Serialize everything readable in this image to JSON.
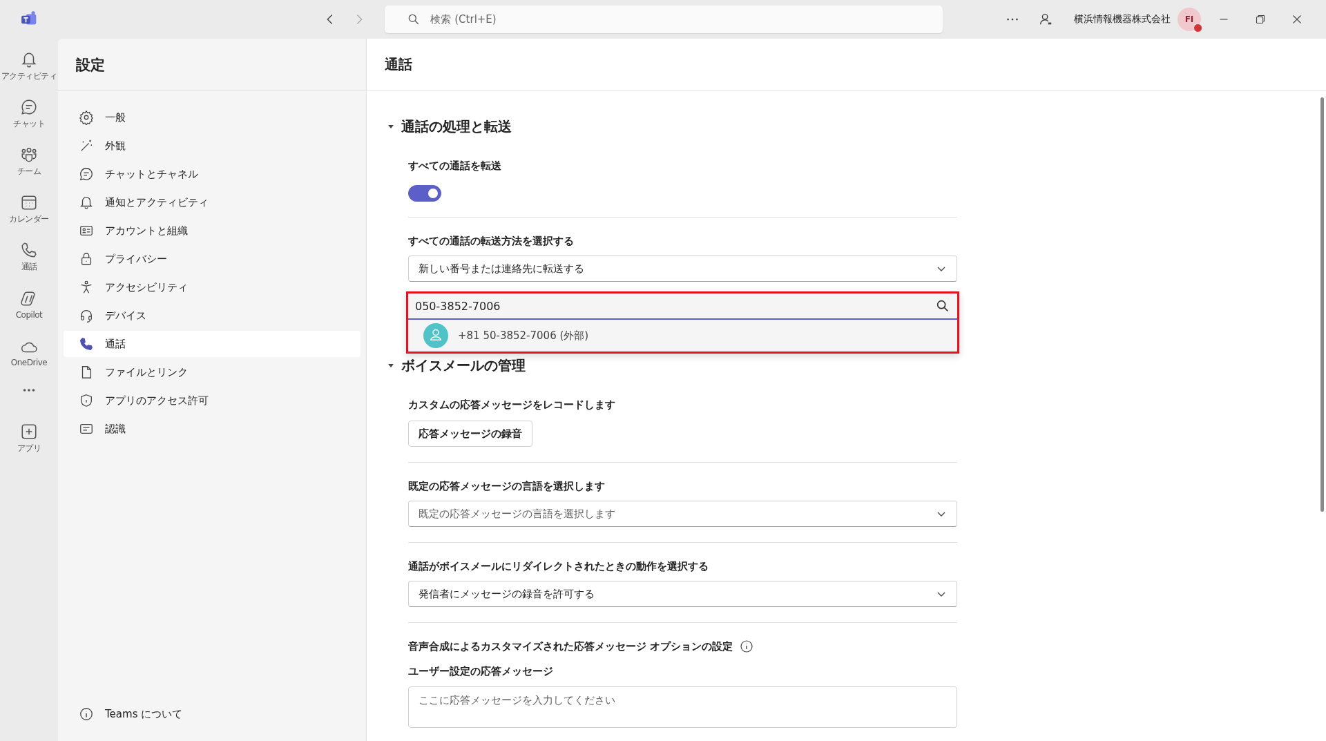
{
  "top_bar": {
    "search": {
      "placeholder": "検索 (Ctrl+E)"
    },
    "organization": "横浜情報機器株式会社",
    "avatar_initials": "FI"
  },
  "app_rail": [
    {
      "label": "アクティビティ",
      "selected": false
    },
    {
      "label": "チャット",
      "selected": false
    },
    {
      "label": "チーム",
      "selected": false
    },
    {
      "label": "カレンダー",
      "selected": false
    },
    {
      "label": "通話",
      "selected": false
    },
    {
      "label": "Copilot",
      "selected": false
    },
    {
      "label": "OneDrive",
      "selected": false
    },
    {
      "label": "アプリ",
      "selected": false
    }
  ],
  "settings_sidebar": {
    "title": "設定",
    "items": [
      {
        "label": "一般",
        "selected": false
      },
      {
        "label": "外観",
        "selected": false
      },
      {
        "label": "チャットとチャネル",
        "selected": false
      },
      {
        "label": "通知とアクティビティ",
        "selected": false
      },
      {
        "label": "アカウントと組織",
        "selected": false
      },
      {
        "label": "プライバシー",
        "selected": false
      },
      {
        "label": "アクセシビリティ",
        "selected": false
      },
      {
        "label": "デバイス",
        "selected": false
      },
      {
        "label": "通話",
        "selected": true
      },
      {
        "label": "ファイルとリンク",
        "selected": false
      },
      {
        "label": "アプリのアクセス許可",
        "selected": false
      },
      {
        "label": "認識",
        "selected": false
      }
    ],
    "footer": "Teams について"
  },
  "page": {
    "title": "通話",
    "sections": [
      {
        "heading": "通話の処理と転送",
        "expanded": true,
        "items": [
          {
            "kind": "toggle",
            "label": "すべての通話を転送",
            "on": true
          },
          {
            "kind": "select",
            "label": "すべての通話の転送方法を選択する",
            "value": "新しい番号または連絡先に転送する",
            "search": {
              "value": "050-3852-7006",
              "suggestion": "+81 50-3852-7006 (外部)"
            }
          }
        ]
      },
      {
        "heading": "ボイスメールの管理",
        "expanded": true,
        "items": [
          {
            "kind": "button",
            "label": "カスタムの応答メッセージをレコードします",
            "button": "応答メッセージの録音"
          },
          {
            "kind": "select",
            "label": "既定の応答メッセージの言語を選択します",
            "placeholder": "既定の応答メッセージの言語を選択します"
          },
          {
            "kind": "select",
            "label": "通話がボイスメールにリダイレクトされたときの動作を選択する",
            "value": "発信者にメッセージの録音を許可する"
          },
          {
            "kind": "textgroup",
            "label": "音声合成によるカスタマイズされた応答メッセージ オプションの設定",
            "sublabel": "ユーザー設定の応答メッセージ",
            "placeholder": "ここに応答メッセージを入力してください"
          }
        ]
      }
    ]
  }
}
